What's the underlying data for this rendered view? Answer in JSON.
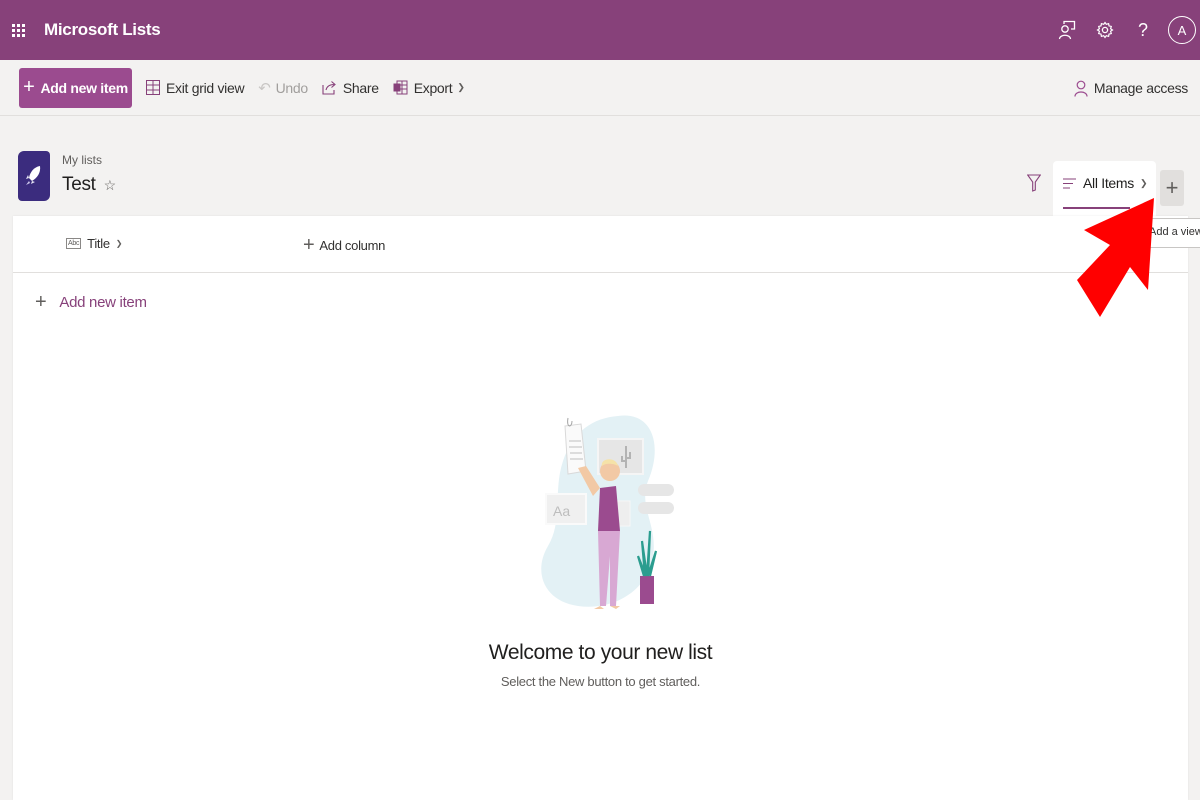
{
  "suite_header": {
    "app_title": "Microsoft Lists",
    "icons": [
      "app-launcher-icon",
      "feedback-icon",
      "settings-icon",
      "help-icon"
    ],
    "help_glyph": "?",
    "avatar_initial": "A"
  },
  "command_bar": {
    "add_new_item": "Add new item",
    "exit_grid_view": "Exit grid view",
    "undo": "Undo",
    "share": "Share",
    "export": "Export",
    "manage_access": "Manage access"
  },
  "list_header": {
    "breadcrumb": "My lists",
    "title": "Test",
    "view_name": "All Items",
    "add_view_tooltip": "Add a view"
  },
  "grid": {
    "columns": [
      {
        "label": "Title",
        "type_icon": "Abc"
      }
    ],
    "add_column": "Add column",
    "add_new_item": "Add new item"
  },
  "empty_state": {
    "heading": "Welcome to your new list",
    "subtext": "Select the New button to get started.",
    "illustration_text": "Aa"
  },
  "colors": {
    "brand": "#87417a",
    "primary_button": "#9b4b8f",
    "list_icon": "#3b2c7e",
    "annotation_arrow": "#ff0000"
  }
}
